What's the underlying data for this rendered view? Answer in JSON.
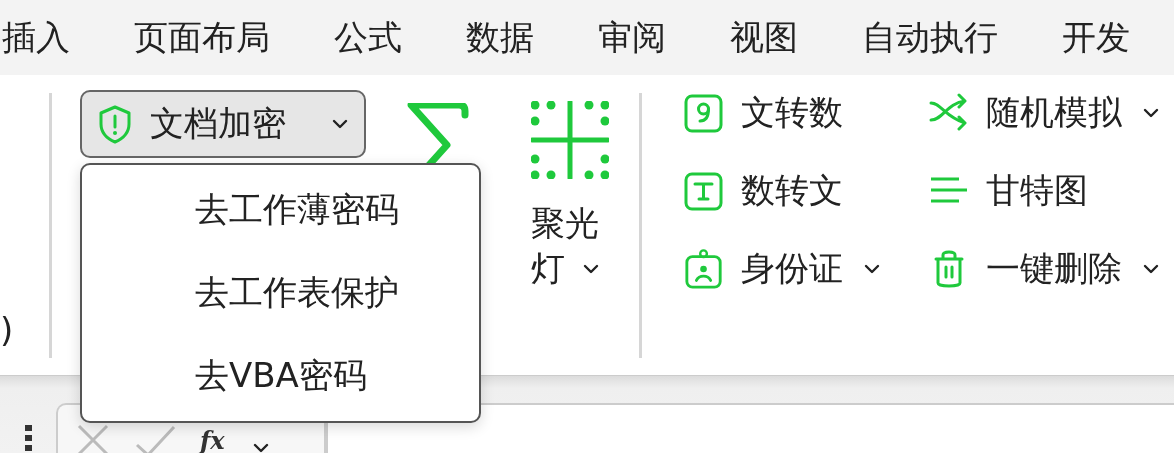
{
  "menu_tabs": [
    {
      "label": "插入",
      "selected": false
    },
    {
      "label": "页面布局",
      "selected": false
    },
    {
      "label": "公式",
      "selected": false
    },
    {
      "label": "数据",
      "selected": false
    },
    {
      "label": "审阅",
      "selected": false
    },
    {
      "label": "视图",
      "selected": false
    },
    {
      "label": "自动执行",
      "selected": false
    },
    {
      "label": "开发",
      "selected": false
    }
  ],
  "ribbon": {
    "left_fragment": ")",
    "encrypt_button": {
      "label": "文档加密",
      "expanded": true
    },
    "encrypt_menu": [
      {
        "label": "去工作薄密码"
      },
      {
        "label": "去工作表保护"
      },
      {
        "label": "去VBA密码"
      }
    ],
    "spotlight": {
      "label_line_1": "聚光",
      "label_line_2": "灯",
      "dropdown": true
    },
    "tools": [
      {
        "label": "文转数",
        "kind": "number",
        "dropdown": false
      },
      {
        "label": "数转文",
        "kind": "text",
        "dropdown": false
      },
      {
        "label": "身份证",
        "kind": "id",
        "dropdown": true
      },
      {
        "label": "随机模拟",
        "kind": "shuffle",
        "dropdown": true
      },
      {
        "label": "甘特图",
        "kind": "gantt",
        "dropdown": false
      },
      {
        "label": "一键删除",
        "kind": "trash",
        "dropdown": true
      }
    ]
  },
  "formula_bar": {
    "function_label": "fx"
  }
}
